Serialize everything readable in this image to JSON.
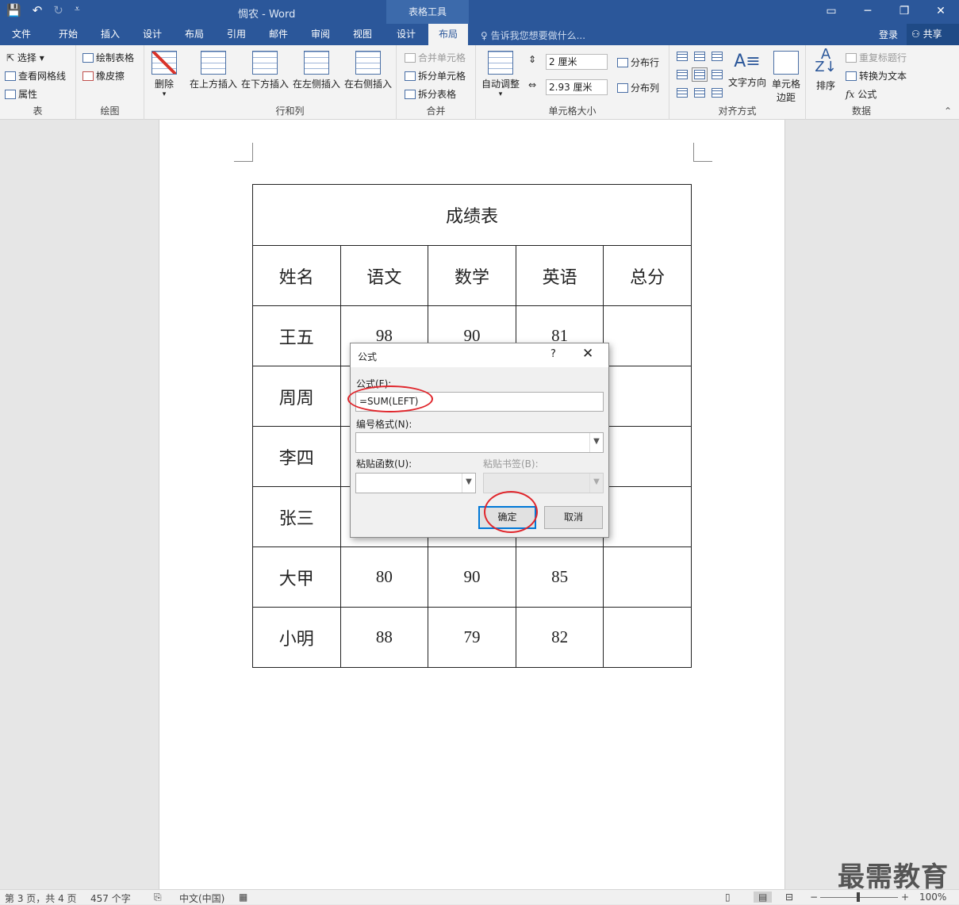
{
  "window": {
    "title": "惆农 - Word",
    "context_tab": "表格工具",
    "min": "─",
    "restore": "❐",
    "close": "✕",
    "ribbon_opts": "▭"
  },
  "qat": {
    "save": "💾",
    "undo": "↶",
    "redo": "↻",
    "customize": "⩡"
  },
  "tabs": [
    "文件",
    "开始",
    "插入",
    "设计",
    "布局",
    "引用",
    "邮件",
    "审阅",
    "视图",
    "设计",
    "布局"
  ],
  "tell_me": "告诉我您想要做什么...",
  "login": "登录",
  "share": "共享",
  "ribbon": {
    "table_group": {
      "label": "表",
      "select": "选择",
      "gridlines": "查看网格线",
      "props": "属性"
    },
    "draw_group": {
      "label": "绘图",
      "draw": "绘制表格",
      "eraser": "橡皮擦"
    },
    "delete": "删除",
    "rows_group": {
      "label": "行和列",
      "above": "在上方插入",
      "below": "在下方插入",
      "left": "在左侧插入",
      "right": "在右侧插入"
    },
    "merge_group": {
      "label": "合并",
      "merge": "合并单元格",
      "split_cells": "拆分单元格",
      "split_table": "拆分表格"
    },
    "size_group": {
      "label": "单元格大小",
      "autofit": "自动调整",
      "height": "2 厘米",
      "width": "2.93 厘米",
      "dist_rows": "分布行",
      "dist_cols": "分布列"
    },
    "align_group": {
      "label": "对齐方式",
      "direction": "文字方向",
      "margins_1": "单元格",
      "margins_2": "边距"
    },
    "data_group": {
      "label": "数据",
      "sort": "排序",
      "repeat": "重复标题行",
      "convert": "转换为文本",
      "formula": "公式",
      "fx": "fx"
    }
  },
  "table": {
    "title": "成绩表",
    "headers": [
      "姓名",
      "语文",
      "数学",
      "英语",
      "总分"
    ],
    "rows": [
      [
        "王五",
        "98",
        "90",
        "81",
        ""
      ],
      [
        "周周",
        "",
        "",
        "",
        ""
      ],
      [
        "李四",
        "",
        "",
        "",
        ""
      ],
      [
        "张三",
        "",
        "",
        "",
        ""
      ],
      [
        "大甲",
        "80",
        "90",
        "85",
        ""
      ],
      [
        "小明",
        "88",
        "79",
        "82",
        ""
      ]
    ]
  },
  "dialog": {
    "title": "公式",
    "help": "?",
    "close": "✕",
    "formula_label": "公式(F):",
    "formula_value": "=SUM(LEFT)",
    "format_label": "编号格式(N):",
    "paste_func_label": "粘贴函数(U):",
    "paste_bm_label": "粘贴书签(B):",
    "ok": "确定",
    "cancel": "取消"
  },
  "status": {
    "page": "第 3 页，共 4 页",
    "words": "457 个字",
    "lang": "中文(中国)",
    "zoom": "100%"
  },
  "watermark": "最需教育",
  "colors": {
    "accent": "#2b579a",
    "highlight_ring": "#e0262c",
    "default_button": "#0078d7"
  }
}
